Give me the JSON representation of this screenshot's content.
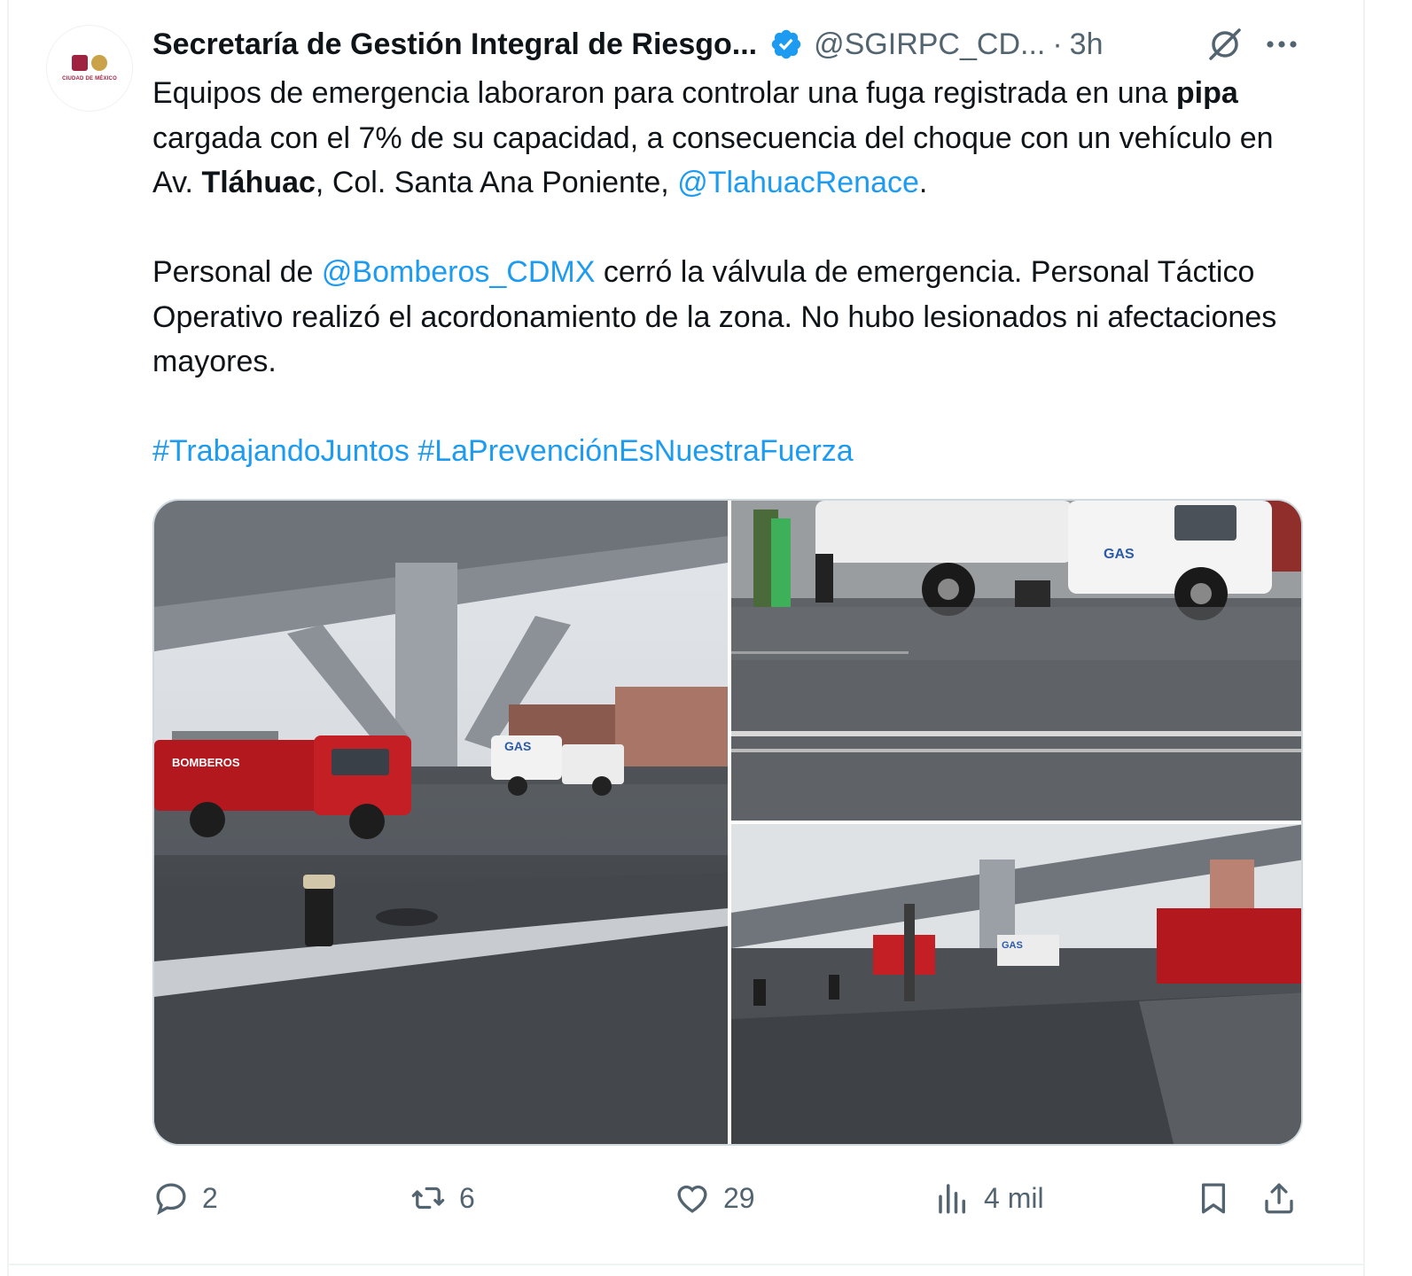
{
  "author": {
    "name": "Secretaría de Gestión Integral de Riesgo...",
    "handle": "@SGIRPC_CD...",
    "separator": "·",
    "time": "3h",
    "avatar_text": "CIUDAD DE MÉXICO"
  },
  "tweet": {
    "p1_s1": "Equipos de emergencia laboraron para controlar una fuga registrada en una ",
    "p1_b1": "pipa",
    "p1_s2": " cargada con el 7% de su capacidad, a consecuencia del choque con un vehículo en Av. ",
    "p1_b2": "Tláhuac",
    "p1_s3": ", Col. Santa Ana Poniente, ",
    "p1_mention": "@TlahuacRenace",
    "p1_end": ".",
    "p2_s1": "Personal de ",
    "p2_mention": "@Bomberos_CDMX",
    "p2_s2": " cerró la válvula de emergencia. Personal Táctico Operativo realizó el acordonamiento de la zona. No hubo lesionados ni afectaciones mayores.",
    "hashtag1": "#TrabajandoJuntos",
    "hashtag_sep": " ",
    "hashtag2": "#LaPrevenciónEsNuestraFuerza"
  },
  "photo_text": {
    "gas_label": "GAS",
    "truck_label": "BOMBEROS"
  },
  "actions": {
    "replies": "2",
    "retweets": "6",
    "likes": "29",
    "views": "4 mil"
  },
  "colors": {
    "link": "#1d9bf0",
    "verified": "#1d9bf0",
    "muted": "#536471",
    "fire_truck": "#b3181e"
  },
  "icons": [
    "verified-badge-icon",
    "grok-icon",
    "more-icon",
    "reply-icon",
    "retweet-icon",
    "like-icon",
    "views-icon",
    "bookmark-icon",
    "share-icon"
  ]
}
